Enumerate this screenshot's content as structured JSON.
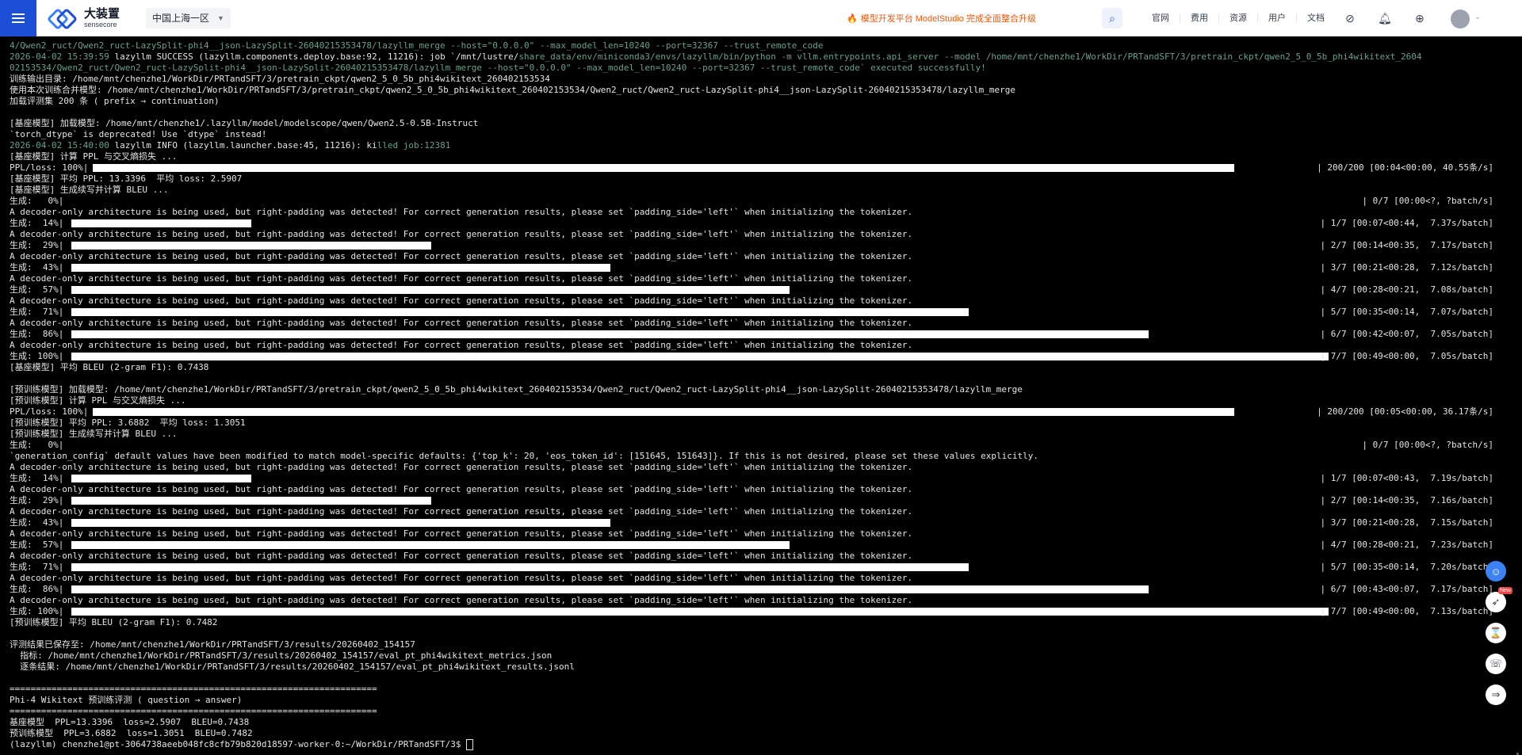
{
  "topbar": {
    "brand_cn": "大装置",
    "brand_en": "sensecore",
    "region": "中国上海一区",
    "notice": "模型开发平台 ModelStudio 完成全面整合升级",
    "nav_links": [
      "官网",
      "费用",
      "资源",
      "用户",
      "文档"
    ]
  },
  "terminal": {
    "lines": [
      {
        "text": "4/Qwen2_ruct/Qwen2_ruct-LazySplit-phi4__json-LazySplit-26040215353478/lazyllm_merge --host=\"0.0.0.0\" --max_model_len=10240 --port=32367 --trust_remote_code",
        "style": "dim"
      },
      {
        "text": "2026-04-02 15:39:59 lazyllm SUCCESS (lazyllm.components.deploy.base:92, 11216): job `/mnt/lustre/share_data/env/miniconda3/envs/lazyllm/bin/python -m vllm.entrypoints.api_server --model /home/mnt/chenzhe1/WorkDir/PRTandSFT/3/pretrain_ckpt/qwen2_5_0_5b_phi4wikitext_2604",
        "style": "mixed"
      },
      {
        "text": "02153534/Qwen2_ruct/Qwen2_ruct-LazySplit-phi4__json-LazySplit-26040215353478/lazyllm_merge --host=\"0.0.0.0\" --max_model_len=10240 --port=32367 --trust_remote_code` executed successfully!",
        "style": "dim"
      },
      {
        "text": "训练输出目录: /home/mnt/chenzhe1/WorkDir/PRTandSFT/3/pretrain_ckpt/qwen2_5_0_5b_phi4wikitext_260402153534"
      },
      {
        "text": "使用本次训练合并模型: /home/mnt/chenzhe1/WorkDir/PRTandSFT/3/pretrain_ckpt/qwen2_5_0_5b_phi4wikitext_260402153534/Qwen2_ruct/Qwen2_ruct-LazySplit-phi4__json-LazySplit-26040215353478/lazyllm_merge"
      },
      {
        "text": "加载评测集 200 条 ( prefix → continuation)"
      },
      {
        "text": ""
      },
      {
        "text": "[基座模型] 加载模型: /home/mnt/chenzhe1/.lazyllm/model/modelscope/qwen/Qwen2.5-0.5B-Instruct"
      },
      {
        "text": "`torch_dtype` is deprecated! Use `dtype` instead!"
      },
      {
        "text": "2026-04-02 15:40:00 lazyllm INFO (lazyllm.launcher.base:45, 11216): killed job:12381",
        "style": "info"
      },
      {
        "text": "[基座模型] 计算 PPL 与交叉熵损失 ..."
      },
      {
        "text": "PPL/loss: 100%|",
        "bar": 1.0,
        "right": "| 200/200 [00:04<00:00, 40.55条/s]"
      },
      {
        "text": "[基座模型] 平均 PPL: 13.3396  平均 loss: 2.5907"
      },
      {
        "text": "[基座模型] 生成续写并计算 BLEU ..."
      },
      {
        "text": "生成:   0%|",
        "bar": 0,
        "right": "| 0/7 [00:00<?, ?batch/s]"
      },
      {
        "text": "A decoder-only architecture is being used, but right-padding was detected! For correct generation results, please set `padding_side='left'` when initializing the tokenizer."
      },
      {
        "text": "生成:  14%|",
        "bar": 0.143,
        "right": "| 1/7 [00:07<00:44,  7.37s/batch]"
      },
      {
        "text": "A decoder-only architecture is being used, but right-padding was detected! For correct generation results, please set `padding_side='left'` when initializing the tokenizer."
      },
      {
        "text": "生成:  29%|",
        "bar": 0.286,
        "right": "| 2/7 [00:14<00:35,  7.17s/batch]"
      },
      {
        "text": "A decoder-only architecture is being used, but right-padding was detected! For correct generation results, please set `padding_side='left'` when initializing the tokenizer."
      },
      {
        "text": "生成:  43%|",
        "bar": 0.429,
        "right": "| 3/7 [00:21<00:28,  7.12s/batch]"
      },
      {
        "text": "A decoder-only architecture is being used, but right-padding was detected! For correct generation results, please set `padding_side='left'` when initializing the tokenizer."
      },
      {
        "text": "生成:  57%|",
        "bar": 0.571,
        "right": "| 4/7 [00:28<00:21,  7.08s/batch]"
      },
      {
        "text": "A decoder-only architecture is being used, but right-padding was detected! For correct generation results, please set `padding_side='left'` when initializing the tokenizer."
      },
      {
        "text": "生成:  71%|",
        "bar": 0.714,
        "right": "| 5/7 [00:35<00:14,  7.07s/batch]"
      },
      {
        "text": "A decoder-only architecture is being used, but right-padding was detected! For correct generation results, please set `padding_side='left'` when initializing the tokenizer."
      },
      {
        "text": "生成:  86%|",
        "bar": 0.857,
        "right": "| 6/7 [00:42<00:07,  7.05s/batch]"
      },
      {
        "text": "A decoder-only architecture is being used, but right-padding was detected! For correct generation results, please set `padding_side='left'` when initializing the tokenizer."
      },
      {
        "text": "生成: 100%|",
        "bar": 1.0,
        "right": "| 7/7 [00:49<00:00,  7.05s/batch]"
      },
      {
        "text": "[基座模型] 平均 BLEU (2-gram F1): 0.7438"
      },
      {
        "text": ""
      },
      {
        "text": "[预训练模型] 加载模型: /home/mnt/chenzhe1/WorkDir/PRTandSFT/3/pretrain_ckpt/qwen2_5_0_5b_phi4wikitext_260402153534/Qwen2_ruct/Qwen2_ruct-LazySplit-phi4__json-LazySplit-26040215353478/lazyllm_merge"
      },
      {
        "text": "[预训练模型] 计算 PPL 与交叉熵损失 ..."
      },
      {
        "text": "PPL/loss: 100%|",
        "bar": 1.0,
        "right": "| 200/200 [00:05<00:00, 36.17条/s]"
      },
      {
        "text": "[预训练模型] 平均 PPL: 3.6882  平均 loss: 1.3051"
      },
      {
        "text": "[预训练模型] 生成续写并计算 BLEU ..."
      },
      {
        "text": "生成:   0%|",
        "bar": 0,
        "right": "| 0/7 [00:00<?, ?batch/s]"
      },
      {
        "text": "`generation_config` default values have been modified to match model-specific defaults: {'top_k': 20, 'eos_token_id': [151645, 151643]}. If this is not desired, please set these values explicitly."
      },
      {
        "text": "A decoder-only architecture is being used, but right-padding was detected! For correct generation results, please set `padding_side='left'` when initializing the tokenizer."
      },
      {
        "text": "生成:  14%|",
        "bar": 0.143,
        "right": "| 1/7 [00:07<00:43,  7.19s/batch]"
      },
      {
        "text": "A decoder-only architecture is being used, but right-padding was detected! For correct generation results, please set `padding_side='left'` when initializing the tokenizer."
      },
      {
        "text": "生成:  29%|",
        "bar": 0.286,
        "right": "| 2/7 [00:14<00:35,  7.16s/batch]"
      },
      {
        "text": "A decoder-only architecture is being used, but right-padding was detected! For correct generation results, please set `padding_side='left'` when initializing the tokenizer."
      },
      {
        "text": "生成:  43%|",
        "bar": 0.429,
        "right": "| 3/7 [00:21<00:28,  7.15s/batch]"
      },
      {
        "text": "A decoder-only architecture is being used, but right-padding was detected! For correct generation results, please set `padding_side='left'` when initializing the tokenizer."
      },
      {
        "text": "生成:  57%|",
        "bar": 0.571,
        "right": "| 4/7 [00:28<00:21,  7.23s/batch]"
      },
      {
        "text": "A decoder-only architecture is being used, but right-padding was detected! For correct generation results, please set `padding_side='left'` when initializing the tokenizer."
      },
      {
        "text": "生成:  71%|",
        "bar": 0.714,
        "right": "| 5/7 [00:35<00:14,  7.20s/batch]"
      },
      {
        "text": "A decoder-only architecture is being used, but right-padding was detected! For correct generation results, please set `padding_side='left'` when initializing the tokenizer."
      },
      {
        "text": "生成:  86%|",
        "bar": 0.857,
        "right": "| 6/7 [00:43<00:07,  7.17s/batch]"
      },
      {
        "text": "A decoder-only architecture is being used, but right-padding was detected! For correct generation results, please set `padding_side='left'` when initializing the tokenizer."
      },
      {
        "text": "生成: 100%|",
        "bar": 1.0,
        "right": "| 7/7 [00:49<00:00,  7.13s/batch]"
      },
      {
        "text": "[预训练模型] 平均 BLEU (2-gram F1): 0.7482"
      },
      {
        "text": ""
      },
      {
        "text": "评测结果已保存至: /home/mnt/chenzhe1/WorkDir/PRTandSFT/3/results/20260402_154157"
      },
      {
        "text": "  指标: /home/mnt/chenzhe1/WorkDir/PRTandSFT/3/results/20260402_154157/eval_pt_phi4wikitext_metrics.json"
      },
      {
        "text": "  逐条结果: /home/mnt/chenzhe1/WorkDir/PRTandSFT/3/results/20260402_154157/eval_pt_phi4wikitext_results.jsonl"
      },
      {
        "text": ""
      },
      {
        "text": "======================================================================"
      },
      {
        "text": "Phi-4 Wikitext 预训练评测 ( question → answer)"
      },
      {
        "text": "======================================================================"
      },
      {
        "text": "基座模型  PPL=13.3396  loss=2.5907  BLEU=0.7438"
      },
      {
        "text": "预训练模型  PPL=3.6882  loss=1.3051  BLEU=0.7482"
      },
      {
        "text": "(lazyllm) chenzhe1@pt-3064738aeeb048fc8cfb79b820d18597-worker-0:~/WorkDir/PRTandSFT/3$ ",
        "prompt": true
      }
    ]
  },
  "float_tools": {
    "new_badge": "New"
  },
  "colors": {
    "accent": "#1d4ed8",
    "terminal_bg": "#000000",
    "terminal_text": "#e5e5e5",
    "log_dim": "#6aa089",
    "notice": "#ea580c"
  }
}
